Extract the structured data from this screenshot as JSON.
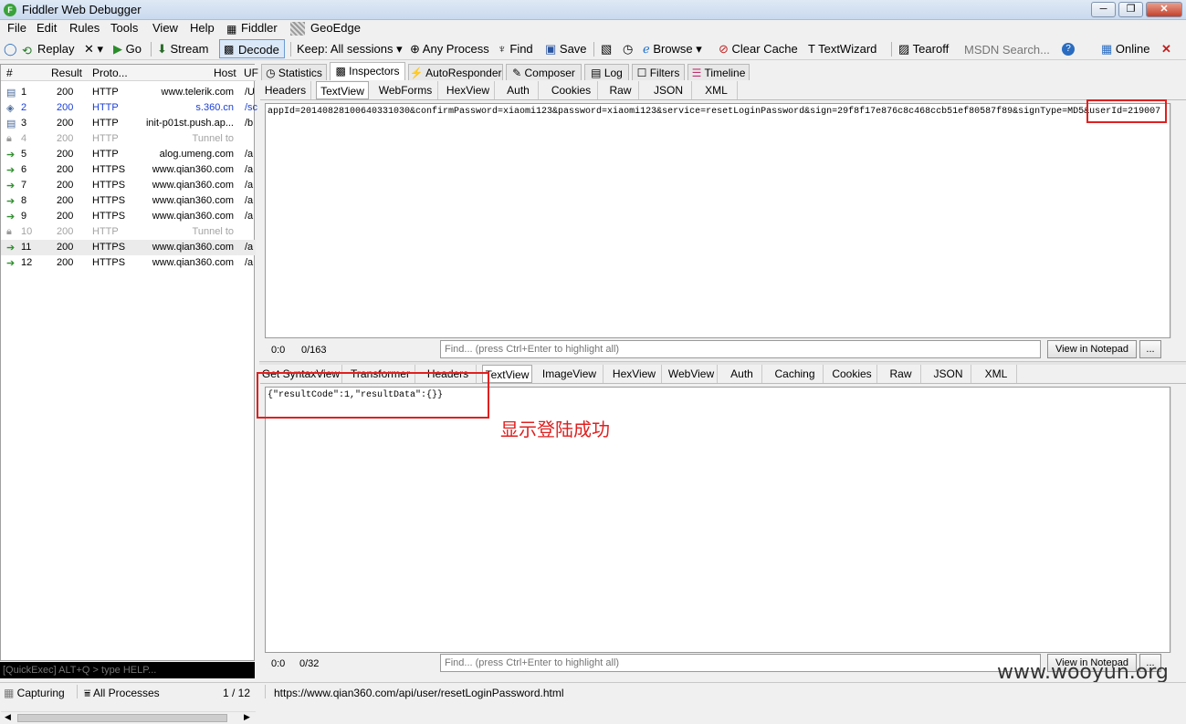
{
  "window": {
    "title": "Fiddler Web Debugger",
    "app_icon_letter": "F",
    "minimize": "─",
    "maximize": "❐",
    "close": "✕"
  },
  "menu": [
    "File",
    "Edit",
    "Rules",
    "Tools",
    "View",
    "Help",
    "Fiddler",
    "GeoEdge"
  ],
  "toolbar": {
    "replay": "Replay",
    "remove": "✕ ▾",
    "go": "Go",
    "stream": "Stream",
    "decode": "Decode",
    "keep": "Keep: All sessions ▾",
    "process": "Any Process",
    "find": "Find",
    "save": "Save",
    "browse": "Browse ▾",
    "clear_cache": "Clear Cache",
    "textwizard": "TextWizard",
    "tearoff": "Tearoff",
    "msdn_placeholder": "MSDN Search...",
    "help": "?",
    "online": "Online",
    "close_x": "✕"
  },
  "sessions": {
    "columns": [
      "#",
      "Result",
      "Proto...",
      "Host",
      "UF"
    ],
    "rows": [
      {
        "num": "1",
        "result": "200",
        "proto": "HTTP",
        "host": "www.telerik.com",
        "url": "/U",
        "style": "normal",
        "icon": "doc-icon"
      },
      {
        "num": "2",
        "result": "200",
        "proto": "HTTP",
        "host": "s.360.cn",
        "url": "/sc",
        "style": "blue",
        "icon": "diamond-arrows-icon"
      },
      {
        "num": "3",
        "result": "200",
        "proto": "HTTP",
        "host": "init-p01st.push.ap...",
        "url": "/b",
        "style": "normal",
        "icon": "doc-icon"
      },
      {
        "num": "4",
        "result": "200",
        "proto": "HTTP",
        "host": "Tunnel to",
        "url": "",
        "style": "gray",
        "icon": "lock-icon"
      },
      {
        "num": "5",
        "result": "200",
        "proto": "HTTP",
        "host": "alog.umeng.com",
        "url": "/a",
        "style": "normal",
        "icon": "arrow-icon"
      },
      {
        "num": "6",
        "result": "200",
        "proto": "HTTPS",
        "host": "www.qian360.com",
        "url": "/a",
        "style": "normal",
        "icon": "arrow-icon"
      },
      {
        "num": "7",
        "result": "200",
        "proto": "HTTPS",
        "host": "www.qian360.com",
        "url": "/a",
        "style": "normal",
        "icon": "arrow-icon"
      },
      {
        "num": "8",
        "result": "200",
        "proto": "HTTPS",
        "host": "www.qian360.com",
        "url": "/a",
        "style": "normal",
        "icon": "arrow-icon"
      },
      {
        "num": "9",
        "result": "200",
        "proto": "HTTPS",
        "host": "www.qian360.com",
        "url": "/a",
        "style": "normal",
        "icon": "arrow-icon"
      },
      {
        "num": "10",
        "result": "200",
        "proto": "HTTP",
        "host": "Tunnel to",
        "url": "",
        "style": "gray",
        "icon": "lock-icon"
      },
      {
        "num": "11",
        "result": "200",
        "proto": "HTTPS",
        "host": "www.qian360.com",
        "url": "/a",
        "style": "selected",
        "icon": "arrow-icon"
      },
      {
        "num": "12",
        "result": "200",
        "proto": "HTTPS",
        "host": "www.qian360.com",
        "url": "/a",
        "style": "normal",
        "icon": "arrow-icon"
      }
    ],
    "quickexec": "[QuickExec] ALT+Q > type HELP..."
  },
  "main_tabs": [
    "Statistics",
    "Inspectors",
    "AutoResponder",
    "Composer",
    "Log",
    "Filters",
    "Timeline"
  ],
  "request": {
    "tabs": [
      "Headers",
      "TextView",
      "WebForms",
      "HexView",
      "Auth",
      "Cookies",
      "Raw",
      "JSON",
      "XML"
    ],
    "body": "appId=20140828100640331030&confirmPassword=xiaomi123&password=xiaomi123&service=resetLoginPassword&sign=29f8f17e876c8c468ccb51ef80587f89&signType=MD5&userId=219007",
    "pos": "0:0",
    "count": "0/163",
    "find_placeholder": "Find... (press Ctrl+Enter to highlight all)",
    "notepad": "View in Notepad",
    "more": "..."
  },
  "response": {
    "tabs": [
      "Get SyntaxView",
      "Transformer",
      "Headers",
      "TextView",
      "ImageView",
      "HexView",
      "WebView",
      "Auth",
      "Caching",
      "Cookies",
      "Raw",
      "JSON",
      "XML"
    ],
    "body": "{\"resultCode\":1,\"resultData\":{}}",
    "pos": "0:0",
    "count": "0/32",
    "find_placeholder": "Find... (press Ctrl+Enter to highlight all)",
    "notepad": "View in Notepad",
    "more": "..."
  },
  "annotation": "显示登陆成功",
  "statusbar": {
    "capturing": "Capturing",
    "processes": "All Processes",
    "count": "1 / 12",
    "url": "https://www.qian360.com/api/user/resetLoginPassword.html"
  },
  "watermark": "www.wooyun.org",
  "colors": {
    "highlight_red": "#e02020",
    "link_blue": "#1a3fd6"
  }
}
